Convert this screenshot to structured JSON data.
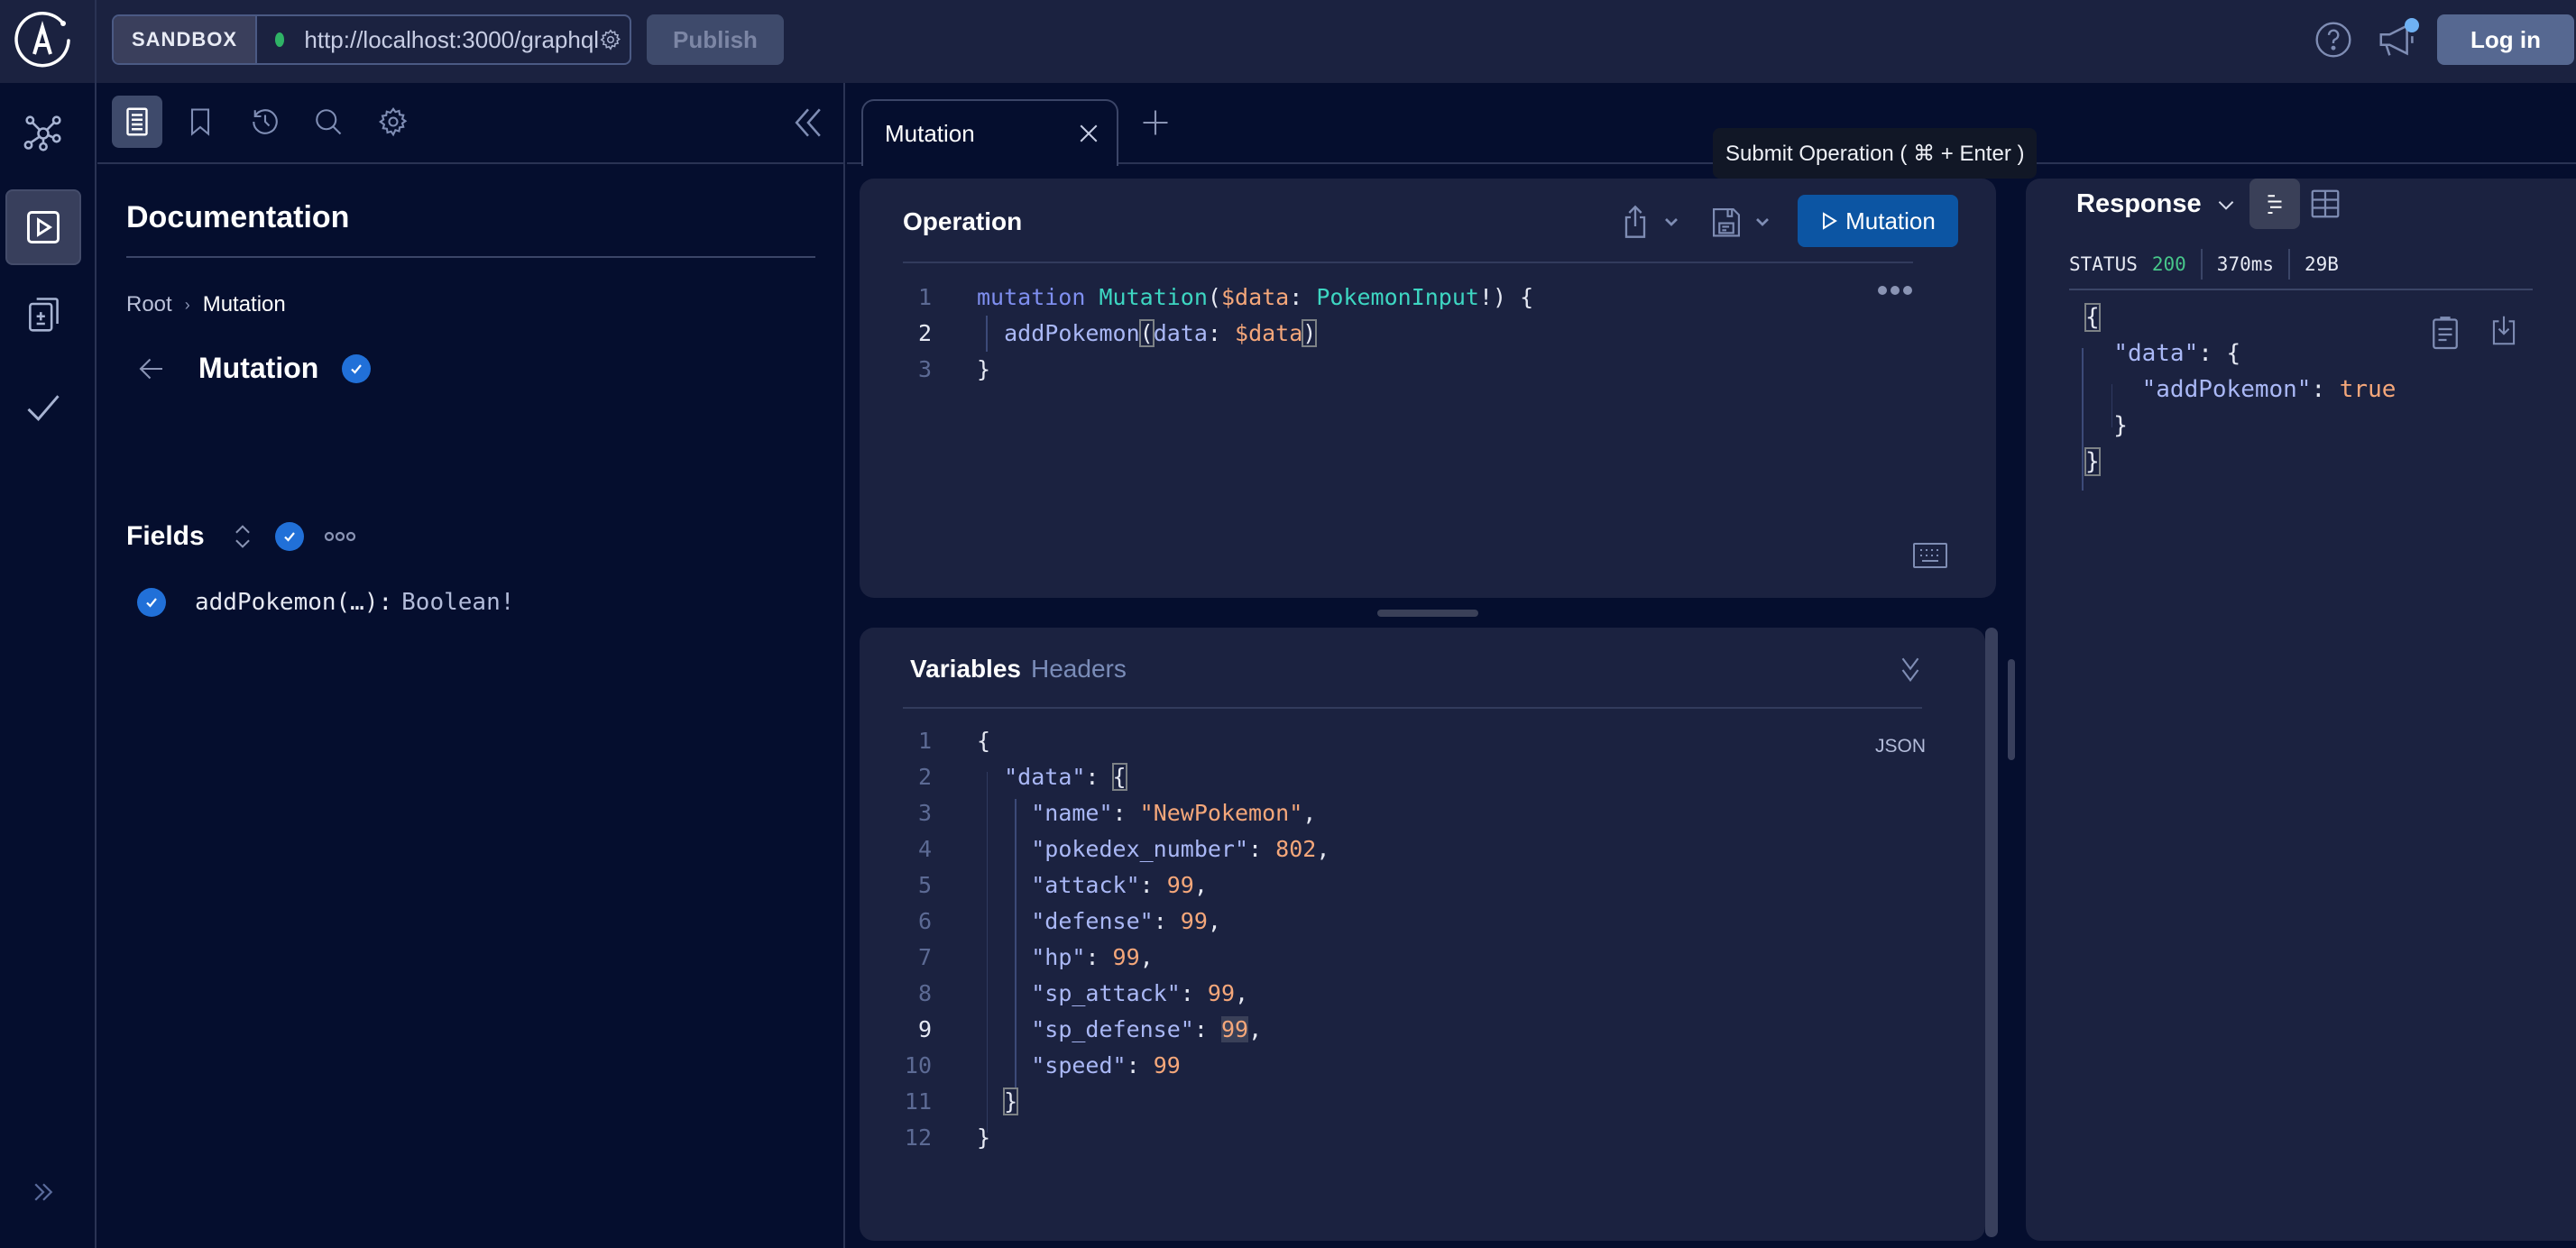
{
  "topbar": {
    "sandbox_label": "SANDBOX",
    "endpoint_url": "http://localhost:3000/graphql",
    "endpoint_status_color": "#2fb366",
    "publish_label": "Publish",
    "login_label": "Log in"
  },
  "rail": {
    "items": [
      {
        "icon": "schema-graph-icon",
        "label": "Schema"
      },
      {
        "icon": "explorer-play-icon",
        "label": "Explorer",
        "active": true
      },
      {
        "icon": "schema-diff-icon",
        "label": "Changelog"
      },
      {
        "icon": "checks-icon",
        "label": "Checks"
      }
    ],
    "expand_icon": "double-chevron-right-icon"
  },
  "docs": {
    "toolbar": [
      {
        "icon": "documentation-icon",
        "active": true
      },
      {
        "icon": "bookmark-icon"
      },
      {
        "icon": "history-icon"
      },
      {
        "icon": "search-icon"
      },
      {
        "icon": "settings-gear-icon"
      }
    ],
    "title": "Documentation",
    "breadcrumb": {
      "root": "Root",
      "separator": "›",
      "current": "Mutation"
    },
    "type_name": "Mutation",
    "fields_label": "Fields",
    "field": {
      "name": "addPokemon(…)",
      "colon": ":",
      "type": "Boolean!"
    }
  },
  "tabs": [
    {
      "label": "Mutation",
      "active": true
    }
  ],
  "tooltip": "Submit Operation ( ⌘ + Enter )",
  "operation": {
    "title": "Operation",
    "run_label": "Mutation",
    "lines": [
      {
        "n": "1",
        "tokens": [
          [
            "kw",
            "mutation"
          ],
          [
            "pun",
            " "
          ],
          [
            "ty",
            "Mutation"
          ],
          [
            "pun",
            "("
          ],
          [
            "var",
            "$data"
          ],
          [
            "pun",
            ": "
          ],
          [
            "ty",
            "PokemonInput"
          ],
          [
            "pun",
            "!) {"
          ]
        ]
      },
      {
        "n": "2",
        "tokens": [
          [
            "pun",
            "  "
          ],
          [
            "fld",
            "addPokemon"
          ],
          [
            "pun hl",
            "("
          ],
          [
            "fld",
            "data"
          ],
          [
            "pun",
            ": "
          ],
          [
            "var",
            "$data"
          ],
          [
            "pun hl",
            ")"
          ]
        ]
      },
      {
        "n": "3",
        "tokens": [
          [
            "pun",
            "}"
          ]
        ]
      }
    ],
    "current_line": "2"
  },
  "variables": {
    "tab_variables": "Variables",
    "tab_headers": "Headers",
    "format_label": "JSON",
    "lines": [
      {
        "n": "1",
        "tokens": [
          [
            "pun",
            "{"
          ]
        ]
      },
      {
        "n": "2",
        "tokens": [
          [
            "pun",
            "  "
          ],
          [
            "key",
            "\"data\""
          ],
          [
            "pun",
            ": "
          ],
          [
            "pun hl",
            "{"
          ]
        ]
      },
      {
        "n": "3",
        "tokens": [
          [
            "pun",
            "    "
          ],
          [
            "key",
            "\"name\""
          ],
          [
            "pun",
            ": "
          ],
          [
            "str",
            "\"NewPokemon\""
          ],
          [
            "pun",
            ","
          ]
        ]
      },
      {
        "n": "4",
        "tokens": [
          [
            "pun",
            "    "
          ],
          [
            "key",
            "\"pokedex_number\""
          ],
          [
            "pun",
            ": "
          ],
          [
            "num",
            "802"
          ],
          [
            "pun",
            ","
          ]
        ]
      },
      {
        "n": "5",
        "tokens": [
          [
            "pun",
            "    "
          ],
          [
            "key",
            "\"attack\""
          ],
          [
            "pun",
            ": "
          ],
          [
            "num",
            "99"
          ],
          [
            "pun",
            ","
          ]
        ]
      },
      {
        "n": "6",
        "tokens": [
          [
            "pun",
            "    "
          ],
          [
            "key",
            "\"defense\""
          ],
          [
            "pun",
            ": "
          ],
          [
            "num",
            "99"
          ],
          [
            "pun",
            ","
          ]
        ]
      },
      {
        "n": "7",
        "tokens": [
          [
            "pun",
            "    "
          ],
          [
            "key",
            "\"hp\""
          ],
          [
            "pun",
            ": "
          ],
          [
            "num",
            "99"
          ],
          [
            "pun",
            ","
          ]
        ]
      },
      {
        "n": "8",
        "tokens": [
          [
            "pun",
            "    "
          ],
          [
            "key",
            "\"sp_attack\""
          ],
          [
            "pun",
            ": "
          ],
          [
            "num",
            "99"
          ],
          [
            "pun",
            ","
          ]
        ]
      },
      {
        "n": "9",
        "tokens": [
          [
            "pun",
            "    "
          ],
          [
            "key",
            "\"sp_defense\""
          ],
          [
            "pun",
            ": "
          ],
          [
            "num sel",
            "99"
          ],
          [
            "pun",
            ","
          ]
        ]
      },
      {
        "n": "10",
        "tokens": [
          [
            "pun",
            "    "
          ],
          [
            "key",
            "\"speed\""
          ],
          [
            "pun",
            ": "
          ],
          [
            "num",
            "99"
          ]
        ]
      },
      {
        "n": "11",
        "tokens": [
          [
            "pun",
            "  "
          ],
          [
            "pun hl",
            "}"
          ]
        ]
      },
      {
        "n": "12",
        "tokens": [
          [
            "pun",
            "}"
          ]
        ]
      }
    ],
    "current_line": "9"
  },
  "response": {
    "title": "Response",
    "status_label": "STATUS",
    "status_code": "200",
    "status_color": "#47c68a",
    "duration": "370ms",
    "size": "29B",
    "lines": [
      {
        "tokens": [
          [
            "pun hl",
            "{"
          ]
        ]
      },
      {
        "tokens": [
          [
            "pun",
            "  "
          ],
          [
            "key",
            "\"data\""
          ],
          [
            "pun",
            ": {"
          ]
        ]
      },
      {
        "tokens": [
          [
            "pun",
            "    "
          ],
          [
            "key",
            "\"addPokemon\""
          ],
          [
            "pun",
            ": "
          ],
          [
            "bool",
            "true"
          ]
        ]
      },
      {
        "tokens": [
          [
            "pun",
            "  }"
          ]
        ]
      },
      {
        "tokens": [
          [
            "pun hl",
            "}"
          ]
        ]
      }
    ]
  }
}
